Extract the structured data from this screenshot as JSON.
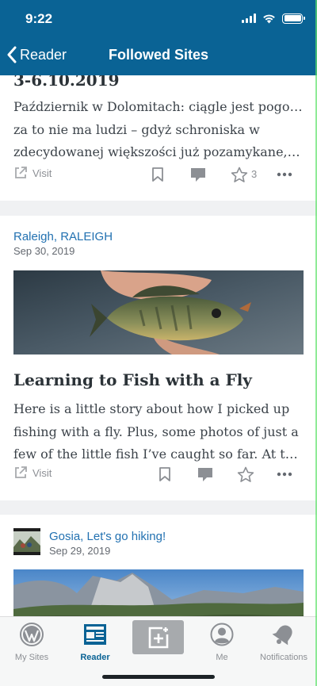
{
  "status_bar": {
    "time": "9:22"
  },
  "nav": {
    "back_label": "Reader",
    "title": "Followed Sites"
  },
  "posts": [
    {
      "title": "3-6.10.2019",
      "excerpt_lines": [
        "Październik w Dolomitach: ciągle jest pogoda,",
        "za to nie ma ludzi – gdyż schroniska w",
        "zdecydowanej większości już pozamykane, let…"
      ],
      "visit_label": "Visit",
      "like_count": "3"
    },
    {
      "site": "Raleigh, RALEIGH",
      "date": "Sep 30, 2019",
      "title": "Learning to Fish with a Fly",
      "excerpt_lines": [
        "Here is a little story about how I picked up",
        "fishing with a fly. Plus, some photos of just a",
        "few of the little fish I’ve caught so far. At the e…"
      ],
      "visit_label": "Visit"
    },
    {
      "site": "Gosia, Let's go hiking!",
      "date": "Sep 29, 2019"
    }
  ],
  "tabbar": {
    "my_sites": "My Sites",
    "reader": "Reader",
    "me": "Me",
    "notifications": "Notifications"
  },
  "colors": {
    "header": "#0a6395",
    "link": "#2271b1",
    "muted": "#8c8f94",
    "active_tab": "#0a6395"
  }
}
